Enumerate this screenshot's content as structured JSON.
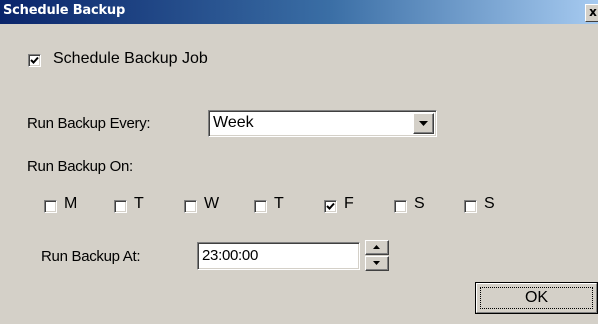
{
  "window": {
    "title": "Schedule Backup",
    "close_glyph": "x"
  },
  "schedule_job": {
    "label": "Schedule Backup Job",
    "checked": true
  },
  "run_every": {
    "label": "Run Backup Every:",
    "selected": "Week"
  },
  "run_on": {
    "label": "Run Backup On:",
    "days": [
      {
        "label": "M",
        "checked": false
      },
      {
        "label": "T",
        "checked": false
      },
      {
        "label": "W",
        "checked": false
      },
      {
        "label": "T",
        "checked": false
      },
      {
        "label": "F",
        "checked": true
      },
      {
        "label": "S",
        "checked": false
      },
      {
        "label": "S",
        "checked": false
      }
    ]
  },
  "run_at": {
    "label": "Run Backup At:",
    "value": "23:00:00"
  },
  "ok_button": {
    "label": "OK"
  },
  "icons": {
    "check": "checkmark-icon",
    "dropdown": "chevron-down-icon",
    "spin_up": "triangle-up-icon",
    "spin_down": "triangle-down-icon"
  }
}
